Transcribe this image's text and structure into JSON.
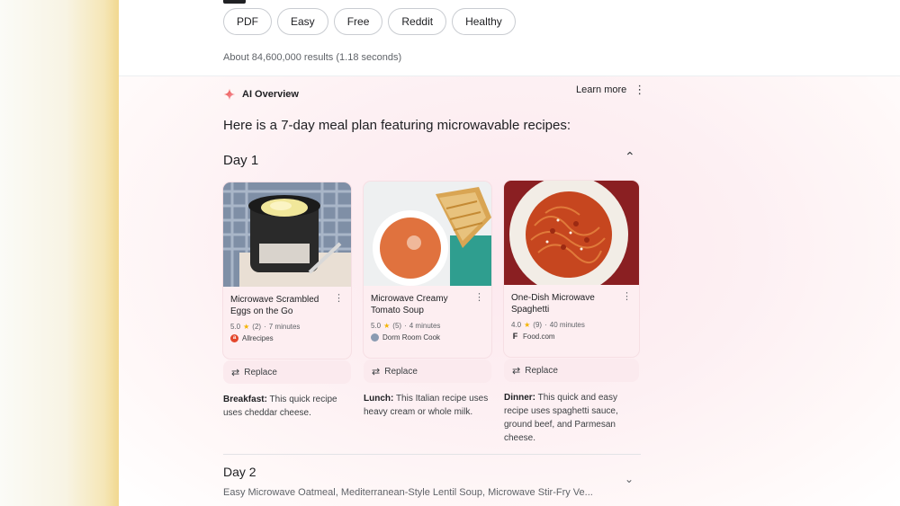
{
  "filters": [
    "PDF",
    "Easy",
    "Free",
    "Reddit",
    "Healthy"
  ],
  "results_count": "About 84,600,000 results (1.18 seconds)",
  "ai_overview": {
    "title": "AI Overview",
    "learn_more": "Learn more",
    "headline": "Here is a 7-day meal plan featuring microwavable recipes:"
  },
  "day1": {
    "heading": "Day 1",
    "recipes": [
      {
        "title": "Microwave Scrambled Eggs on the Go",
        "rating": "5.0",
        "reviews": "(2)",
        "time": "7 minutes",
        "source": "Allrecipes",
        "replace": "Replace",
        "meal": "Breakfast:",
        "description": "This quick recipe uses cheddar cheese."
      },
      {
        "title": "Microwave Creamy Tomato Soup",
        "rating": "5.0",
        "reviews": "(5)",
        "time": "4 minutes",
        "source": "Dorm Room Cook",
        "replace": "Replace",
        "meal": "Lunch:",
        "description": "This Italian recipe uses heavy cream or whole milk."
      },
      {
        "title": "One-Dish Microwave Spaghetti",
        "rating": "4.0",
        "reviews": "(9)",
        "time": "40 minutes",
        "source": "Food.com",
        "replace": "Replace",
        "meal": "Dinner:",
        "description": "This quick and easy recipe uses spaghetti sauce, ground beef, and Parmesan cheese."
      }
    ]
  },
  "day2": {
    "heading": "Day 2",
    "summary": "Easy Microwave Oatmeal, Mediterranean-Style Lentil Soup, Microwave Stir-Fry Ve..."
  },
  "icons": {
    "ai": "sparkle-icon",
    "more": "more-vert-icon",
    "expand": "chevron-up-icon",
    "collapse": "chevron-down-icon",
    "replace": "swap-icon",
    "rating": "star-icon"
  },
  "colors": {
    "ai_spark_start": "#ea4335",
    "ai_spark_end": "#f6a6b8",
    "star": "#f4b400",
    "card_bg": "#fdeef1",
    "allrecipes": "#e3472c",
    "dormroomcook": "#8a9bb2",
    "foodcom": "#202124"
  }
}
